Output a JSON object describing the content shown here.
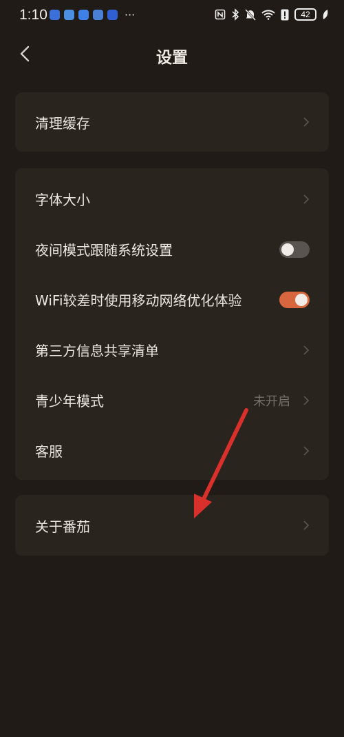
{
  "status_bar": {
    "time": "1:10",
    "more": "···",
    "battery": "42",
    "app_icon_colors": [
      "#3b6fd9",
      "#4a8fe0",
      "#3f7fe8",
      "#4a7fd6",
      "#2f5fd0"
    ]
  },
  "header": {
    "title": "设置",
    "back_icon": "chevron-left-icon"
  },
  "groups": [
    {
      "rows": [
        {
          "label": "清理缓存",
          "type": "link"
        }
      ]
    },
    {
      "rows": [
        {
          "label": "字体大小",
          "type": "link"
        },
        {
          "label": "夜间模式跟随系统设置",
          "type": "toggle",
          "state": "off"
        },
        {
          "label": "WiFi较差时使用移动网络优化体验",
          "type": "toggle",
          "state": "on"
        },
        {
          "label": "第三方信息共享清单",
          "type": "link"
        },
        {
          "label": "青少年模式",
          "type": "link",
          "value": "未开启"
        },
        {
          "label": "客服",
          "type": "link"
        }
      ]
    },
    {
      "rows": [
        {
          "label": "关于番茄",
          "type": "link"
        }
      ]
    }
  ],
  "colors": {
    "background": "#201b16",
    "card": "#2a241f",
    "toggle_on": "#d8663e",
    "toggle_off": "#5a5450",
    "annotation_arrow": "#d9302c"
  }
}
